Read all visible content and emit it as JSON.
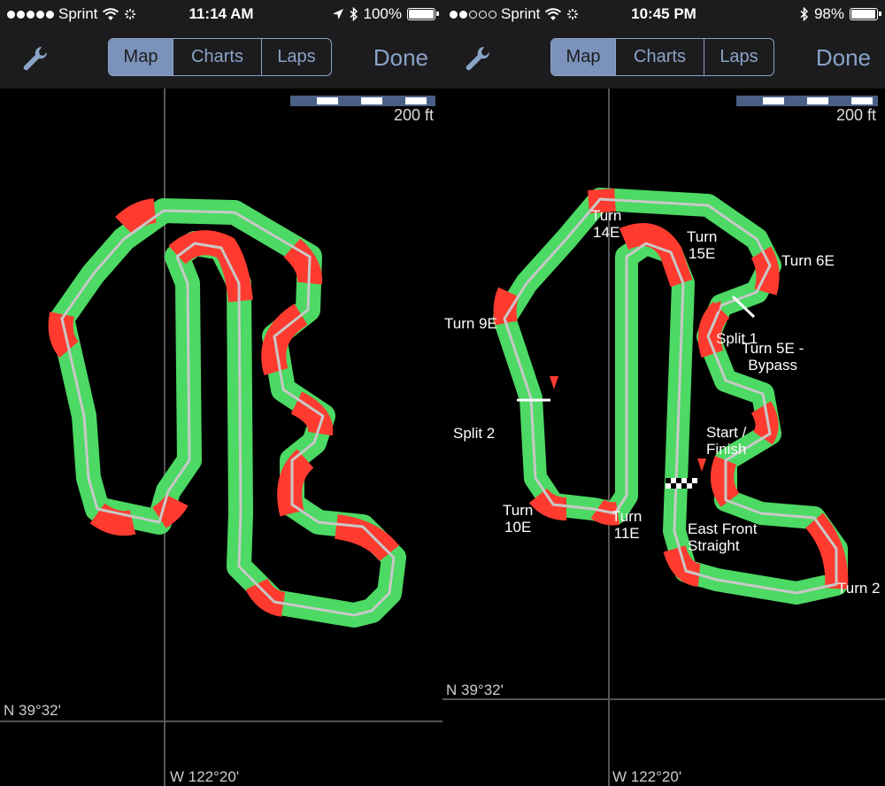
{
  "left": {
    "status": {
      "carrier": "Sprint",
      "time": "11:14 AM",
      "battery": "100%",
      "signal_bars": 5,
      "battery_level": 1.0
    },
    "nav": {
      "tabs": [
        "Map",
        "Charts",
        "Laps"
      ],
      "active_tab": "Map",
      "done": "Done"
    },
    "map": {
      "scale_label": "200 ft",
      "latitude": "N 39°32'",
      "longitude": "W 122°20'"
    }
  },
  "right": {
    "status": {
      "carrier": "Sprint",
      "time": "10:45 PM",
      "battery": "98%",
      "signal_bars": 2,
      "battery_level": 0.98
    },
    "nav": {
      "tabs": [
        "Map",
        "Charts",
        "Laps"
      ],
      "active_tab": "Map",
      "done": "Done"
    },
    "map": {
      "scale_label": "200 ft",
      "latitude": "N 39°32'",
      "longitude": "W 122°20'",
      "labels": {
        "turn14e": "Turn\n14E",
        "turn15e": "Turn\n15E",
        "turn6e": "Turn 6E",
        "turn9e": "Turn 9E",
        "split1": "Split 1",
        "turn5e": "Turn 5E -\nBypass",
        "split2": "Split 2",
        "start_finish": "Start /\nFinish",
        "turn10e": "Turn\n10E",
        "turn11e": "Turn\n11E",
        "east_front": "East Front\nStraight",
        "turn2": "Turn 2"
      }
    }
  },
  "colors": {
    "brake": "#ff3b30",
    "accel": "#4cd964",
    "track_line": "#c8c8c8",
    "accent": "#8aa3c7"
  }
}
